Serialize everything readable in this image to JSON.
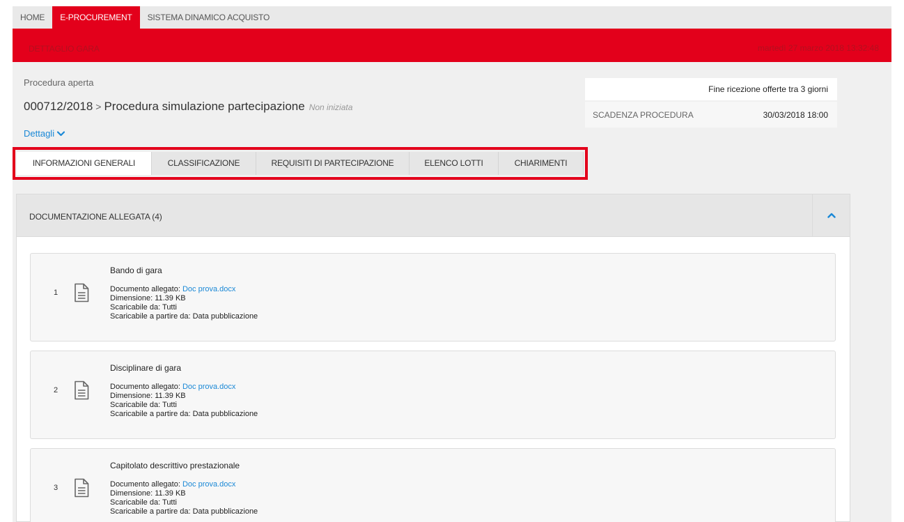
{
  "topnav": {
    "items": [
      {
        "label": "HOME",
        "active": false
      },
      {
        "label": "E-PROCUREMENT",
        "active": true
      },
      {
        "label": "SISTEMA DINAMICO ACQUISTO",
        "active": false
      }
    ]
  },
  "redbar": {
    "title": "DETTAGLIO GARA",
    "datetime": "martedì 27 marzo 2018 13:32:48"
  },
  "header": {
    "procedure_type": "Procedura aperta",
    "code": "000712/2018",
    "separator": ">",
    "name": "Procedura simulazione partecipazione",
    "status": "Non iniziata",
    "details_link": "Dettagli"
  },
  "deadline": {
    "notice": "Fine ricezione offerte tra 3 giorni",
    "label": "SCADENZA PROCEDURA",
    "value": "30/03/2018 18:00"
  },
  "tabs": [
    {
      "label": "INFORMAZIONI GENERALI",
      "active": true
    },
    {
      "label": "CLASSIFICAZIONE",
      "active": false
    },
    {
      "label": "REQUISITI DI PARTECIPAZIONE",
      "active": false
    },
    {
      "label": "ELENCO LOTTI",
      "active": false
    },
    {
      "label": "CHIARIMENTI",
      "active": false
    }
  ],
  "panel": {
    "title": "DOCUMENTAZIONE ALLEGATA (4)",
    "documents": [
      {
        "index": "1",
        "name": "Bando di gara",
        "attached_label": "Documento allegato:",
        "attached_file": "Doc prova.docx",
        "size": "Dimensione: 11.39 KB",
        "downloadable_by": "Scaricabile da: Tutti",
        "downloadable_from": "Scaricabile a partire da: Data pubblicazione"
      },
      {
        "index": "2",
        "name": "Disciplinare di gara",
        "attached_label": "Documento allegato:",
        "attached_file": "Doc prova.docx",
        "size": "Dimensione: 11.39 KB",
        "downloadable_by": "Scaricabile da: Tutti",
        "downloadable_from": "Scaricabile a partire da: Data pubblicazione"
      },
      {
        "index": "3",
        "name": "Capitolato descrittivo prestazionale",
        "attached_label": "Documento allegato:",
        "attached_file": "Doc prova.docx",
        "size": "Dimensione: 11.39 KB",
        "downloadable_by": "Scaricabile da: Tutti",
        "downloadable_from": "Scaricabile a partire da: Data pubblicazione"
      }
    ]
  },
  "colors": {
    "brand_red": "#e3001b",
    "link_blue": "#1a88d6"
  }
}
